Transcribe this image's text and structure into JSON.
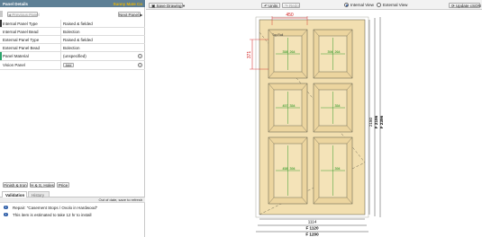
{
  "left": {
    "header": {
      "title": "Panel Details",
      "brand": "Sunny Mate Co"
    },
    "nav": {
      "prev_label": "Previous Panel",
      "next_label": "Next Panel"
    },
    "properties": [
      {
        "key": "Internal Panel Type",
        "value": "Raised & fielded"
      },
      {
        "key": "Internal Panel Bead",
        "value": "Bolection"
      },
      {
        "key": "External Panel Type",
        "value": "Raised & fielded"
      },
      {
        "key": "External Panel Bead",
        "value": "Bolection"
      },
      {
        "key": "Panel Material",
        "value": "(unspecified)"
      },
      {
        "key": "Vision Panel",
        "value": ""
      }
    ],
    "add_label": "Add",
    "buttons": {
      "finish": "Finish & Iron",
      "hs": "H & S, Holes",
      "price": "Price"
    },
    "tabs": {
      "validation": "Validation",
      "history": "History"
    },
    "status": "Out of date, save to refresh",
    "messages": [
      {
        "icon": "i",
        "text": "Repair: \"Casement Stops / Ovolo in Hardwood\""
      },
      {
        "icon": "i",
        "text": "This item is estimated to take 12 hr to install"
      }
    ],
    "colors": {
      "header": "#5d7f95",
      "brand": "#f0b800",
      "marker_green": "#2aa36b",
      "marker_dark": "#333333"
    }
  },
  "toolbar": {
    "save": "Save Drawing",
    "units": "Units",
    "redo": "Redo",
    "internal_view": "Internal View",
    "external_view": "External View",
    "update": "Update cSON",
    "view_selected": "internal"
  },
  "drawing": {
    "colors": {
      "door": "#f2dfb0",
      "line": "#6e6a55",
      "dim_red": "#d01818",
      "dim_green": "#0a8a0a",
      "dim_black": "#111111"
    },
    "top_width_label": "450",
    "left_height_label": "371",
    "panel_labels": [
      {
        "w": "358",
        "h": "264"
      },
      {
        "w": "394",
        "h": "264"
      },
      {
        "w": "457",
        "h": "354"
      },
      {
        "w": "",
        "h": "354"
      },
      {
        "w": "458",
        "h": "394"
      },
      {
        "w": "",
        "h": "394"
      }
    ],
    "panel_ref_text": "Top Rail",
    "bottom_dims": [
      "1114",
      "F 1120",
      "F 1200"
    ],
    "right_dims": [
      "2180",
      "F 2196",
      "F 2396"
    ]
  }
}
